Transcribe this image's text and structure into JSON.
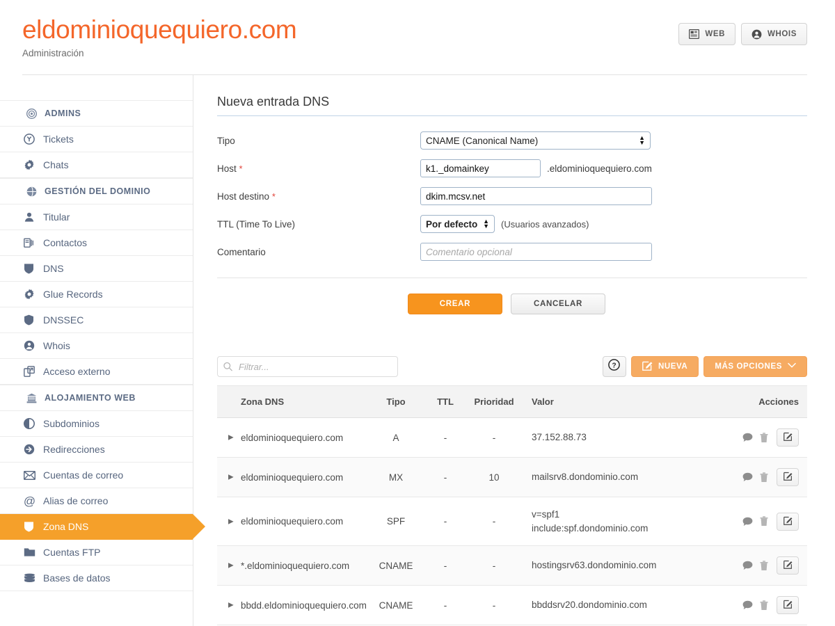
{
  "header": {
    "domain": "eldominioquequiero.com",
    "subtitle": "Administración",
    "buttons": [
      {
        "label": "WEB",
        "icon": "web-page-icon"
      },
      {
        "label": "WHOIS",
        "icon": "user-circle-icon"
      }
    ]
  },
  "sidebar": {
    "sections": [
      {
        "title": "ADMINS",
        "icon": "badge-icon",
        "items": [
          {
            "label": "Tickets",
            "icon": "ticket-icon",
            "active": false
          },
          {
            "label": "Chats",
            "icon": "gear-icon",
            "active": false
          }
        ]
      },
      {
        "title": "GESTIÓN DEL DOMINIO",
        "icon": "globe-icon",
        "items": [
          {
            "label": "Titular",
            "icon": "person-icon",
            "active": false
          },
          {
            "label": "Contactos",
            "icon": "contacts-icon",
            "active": false
          },
          {
            "label": "DNS",
            "icon": "shield-icon",
            "active": false
          },
          {
            "label": "Glue Records",
            "icon": "gear-icon",
            "active": false
          },
          {
            "label": "DNSSEC",
            "icon": "shield-lock-icon",
            "active": false
          },
          {
            "label": "Whois",
            "icon": "user-circle-icon",
            "active": false
          },
          {
            "label": "Acceso externo",
            "icon": "external-window-icon",
            "active": false
          }
        ]
      },
      {
        "title": "ALOJAMIENTO WEB",
        "icon": "bank-icon",
        "items": [
          {
            "label": "Subdominios",
            "icon": "contrast-circle-icon",
            "active": false
          },
          {
            "label": "Redirecciones",
            "icon": "arrow-right-circle-icon",
            "active": false
          },
          {
            "label": "Cuentas de correo",
            "icon": "envelope-icon",
            "active": false
          },
          {
            "label": "Alias de correo",
            "icon": "at-sign-icon",
            "active": false
          },
          {
            "label": "Zona DNS",
            "icon": "shield-icon",
            "active": true
          },
          {
            "label": "Cuentas FTP",
            "icon": "folder-icon",
            "active": false
          },
          {
            "label": "Bases de datos",
            "icon": "database-icon",
            "active": false
          }
        ]
      }
    ]
  },
  "form": {
    "title": "Nueva entrada DNS",
    "fields": {
      "tipo": {
        "label": "Tipo",
        "value": "CNAME (Canonical Name)"
      },
      "host": {
        "label": "Host",
        "required_marker": "*",
        "value": "k1._domainkey",
        "suffix": ".eldominioquequiero.com"
      },
      "host_destino": {
        "label": "Host destino",
        "required_marker": "*",
        "value": "dkim.mcsv.net"
      },
      "ttl": {
        "label": "TTL (Time To Live)",
        "value": "Por defecto",
        "hint": "(Usuarios avanzados)"
      },
      "comentario": {
        "label": "Comentario",
        "value": "",
        "placeholder": "Comentario opcional"
      }
    },
    "submit_label": "CREAR",
    "cancel_label": "CANCELAR"
  },
  "toolbar": {
    "filter_placeholder": "Filtrar...",
    "filter_value": "",
    "filter_icon": "search-icon",
    "help_icon": "question-circle-icon",
    "new_label": "NUEVA",
    "new_icon": "edit-square-icon",
    "more_label": "MÁS OPCIONES",
    "more_icon": "chevron-down-icon"
  },
  "table": {
    "columns": [
      "Zona DNS",
      "Tipo",
      "TTL",
      "Prioridad",
      "Valor",
      "Acciones"
    ],
    "rows": [
      {
        "zona": "eldominioquequiero.com",
        "tipo": "A",
        "ttl": "-",
        "prioridad": "-",
        "valor": "37.152.88.73",
        "valor2": ""
      },
      {
        "zona": "eldominioquequiero.com",
        "tipo": "MX",
        "ttl": "-",
        "prioridad": "10",
        "valor": "mailsrv8.dondominio.com",
        "valor2": ""
      },
      {
        "zona": "eldominioquequiero.com",
        "tipo": "SPF",
        "ttl": "-",
        "prioridad": "-",
        "valor": "v=spf1",
        "valor2": "include:spf.dondominio.com"
      },
      {
        "zona": "*.eldominioquequiero.com",
        "tipo": "CNAME",
        "ttl": "-",
        "prioridad": "-",
        "valor": "hostingsrv63.dondominio.com",
        "valor2": ""
      },
      {
        "zona": "bbdd.eldominioquequiero.com",
        "tipo": "CNAME",
        "ttl": "-",
        "prioridad": "-",
        "valor": "bbddsrv20.dondominio.com",
        "valor2": ""
      }
    ],
    "row_actions": {
      "comment_icon": "speech-bubble-icon",
      "delete_icon": "trash-icon",
      "edit_icon": "edit-square-icon",
      "expand_icon": "caret-right-icon"
    }
  },
  "colors": {
    "brand_orange": "#f4662a",
    "accent_orange": "#f7941e",
    "active_nav_orange": "#f5a02a",
    "muted_orange": "#f6ab62",
    "nav_text": "#56657e",
    "required_red": "#e2443b"
  }
}
